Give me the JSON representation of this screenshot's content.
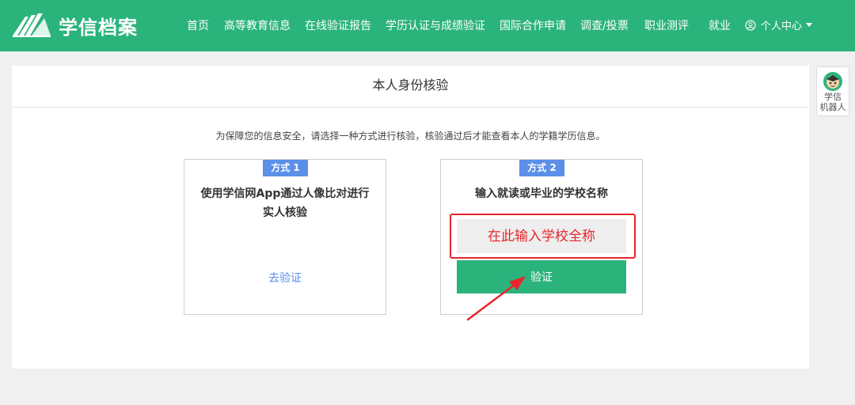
{
  "brand": {
    "name": "学信档案",
    "bar_color": "#2bb37c"
  },
  "nav": {
    "items": [
      "首页",
      "高等教育信息",
      "在线验证报告",
      "学历认证与成绩验证",
      "国际合作申请",
      "调查/投票",
      "职业测评",
      "就业"
    ],
    "user_center": "个人中心"
  },
  "panel": {
    "title": "本人身份核验",
    "notice": "为保障您的信息安全，请选择一种方式进行核验，核验通过后才能查看本人的学籍学历信息。"
  },
  "method1": {
    "badge": "方式 1",
    "title": "使用学信网App通过人像比对进行实人核验",
    "link": "去验证"
  },
  "method2": {
    "badge": "方式 2",
    "title": "输入就读或毕业的学校名称",
    "input_placeholder": "在此输入学校全称",
    "button": "验证"
  },
  "assistant": {
    "label_line1": "学信",
    "label_line2": "机器人",
    "icon": "robot-icon"
  },
  "colors": {
    "accent": "#2bb37c",
    "badge": "#5b8fe8",
    "annotation": "#e8262b"
  }
}
